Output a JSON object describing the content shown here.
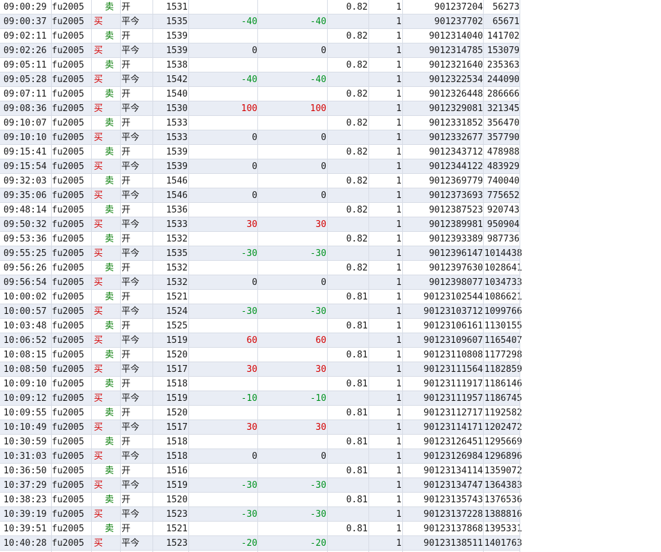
{
  "rows": [
    {
      "time": "09:00:29",
      "code": "fu2005",
      "dir": "卖",
      "oc": "开",
      "price": "1531",
      "pnl": "",
      "pnl2": "",
      "fee": "0.82",
      "qty": "1",
      "order": "901237204",
      "trade": "56273"
    },
    {
      "time": "09:00:37",
      "code": "fu2005",
      "dir": "买",
      "oc": "平今",
      "price": "1535",
      "pnl": "-40",
      "pnl2": "-40",
      "fee": "",
      "qty": "1",
      "order": "901237702",
      "trade": "65671"
    },
    {
      "time": "09:02:11",
      "code": "fu2005",
      "dir": "卖",
      "oc": "开",
      "price": "1539",
      "pnl": "",
      "pnl2": "",
      "fee": "0.82",
      "qty": "1",
      "order": "9012314040",
      "trade": "141702"
    },
    {
      "time": "09:02:26",
      "code": "fu2005",
      "dir": "买",
      "oc": "平今",
      "price": "1539",
      "pnl": "0",
      "pnl2": "0",
      "fee": "",
      "qty": "1",
      "order": "9012314785",
      "trade": "153079"
    },
    {
      "time": "09:05:11",
      "code": "fu2005",
      "dir": "卖",
      "oc": "开",
      "price": "1538",
      "pnl": "",
      "pnl2": "",
      "fee": "0.82",
      "qty": "1",
      "order": "9012321640",
      "trade": "235363"
    },
    {
      "time": "09:05:28",
      "code": "fu2005",
      "dir": "买",
      "oc": "平今",
      "price": "1542",
      "pnl": "-40",
      "pnl2": "-40",
      "fee": "",
      "qty": "1",
      "order": "9012322534",
      "trade": "244090"
    },
    {
      "time": "09:07:11",
      "code": "fu2005",
      "dir": "卖",
      "oc": "开",
      "price": "1540",
      "pnl": "",
      "pnl2": "",
      "fee": "0.82",
      "qty": "1",
      "order": "9012326448",
      "trade": "286666"
    },
    {
      "time": "09:08:36",
      "code": "fu2005",
      "dir": "买",
      "oc": "平今",
      "price": "1530",
      "pnl": "100",
      "pnl2": "100",
      "fee": "",
      "qty": "1",
      "order": "9012329081",
      "trade": "321345"
    },
    {
      "time": "09:10:07",
      "code": "fu2005",
      "dir": "卖",
      "oc": "开",
      "price": "1533",
      "pnl": "",
      "pnl2": "",
      "fee": "0.82",
      "qty": "1",
      "order": "9012331852",
      "trade": "356470"
    },
    {
      "time": "09:10:10",
      "code": "fu2005",
      "dir": "买",
      "oc": "平今",
      "price": "1533",
      "pnl": "0",
      "pnl2": "0",
      "fee": "",
      "qty": "1",
      "order": "9012332677",
      "trade": "357790"
    },
    {
      "time": "09:15:41",
      "code": "fu2005",
      "dir": "卖",
      "oc": "开",
      "price": "1539",
      "pnl": "",
      "pnl2": "",
      "fee": "0.82",
      "qty": "1",
      "order": "9012343712",
      "trade": "478988"
    },
    {
      "time": "09:15:54",
      "code": "fu2005",
      "dir": "买",
      "oc": "平今",
      "price": "1539",
      "pnl": "0",
      "pnl2": "0",
      "fee": "",
      "qty": "1",
      "order": "9012344122",
      "trade": "483929"
    },
    {
      "time": "09:32:03",
      "code": "fu2005",
      "dir": "卖",
      "oc": "开",
      "price": "1546",
      "pnl": "",
      "pnl2": "",
      "fee": "0.82",
      "qty": "1",
      "order": "9012369779",
      "trade": "740040"
    },
    {
      "time": "09:35:06",
      "code": "fu2005",
      "dir": "买",
      "oc": "平今",
      "price": "1546",
      "pnl": "0",
      "pnl2": "0",
      "fee": "",
      "qty": "1",
      "order": "9012373693",
      "trade": "775652"
    },
    {
      "time": "09:48:14",
      "code": "fu2005",
      "dir": "卖",
      "oc": "开",
      "price": "1536",
      "pnl": "",
      "pnl2": "",
      "fee": "0.82",
      "qty": "1",
      "order": "9012387523",
      "trade": "920743"
    },
    {
      "time": "09:50:32",
      "code": "fu2005",
      "dir": "买",
      "oc": "平今",
      "price": "1533",
      "pnl": "30",
      "pnl2": "30",
      "fee": "",
      "qty": "1",
      "order": "9012389981",
      "trade": "950904"
    },
    {
      "time": "09:53:36",
      "code": "fu2005",
      "dir": "卖",
      "oc": "开",
      "price": "1532",
      "pnl": "",
      "pnl2": "",
      "fee": "0.82",
      "qty": "1",
      "order": "9012393389",
      "trade": "987736"
    },
    {
      "time": "09:55:25",
      "code": "fu2005",
      "dir": "买",
      "oc": "平今",
      "price": "1535",
      "pnl": "-30",
      "pnl2": "-30",
      "fee": "",
      "qty": "1",
      "order": "9012396147",
      "trade": "1014438"
    },
    {
      "time": "09:56:26",
      "code": "fu2005",
      "dir": "卖",
      "oc": "开",
      "price": "1532",
      "pnl": "",
      "pnl2": "",
      "fee": "0.82",
      "qty": "1",
      "order": "9012397630",
      "trade": "1028641"
    },
    {
      "time": "09:56:54",
      "code": "fu2005",
      "dir": "买",
      "oc": "平今",
      "price": "1532",
      "pnl": "0",
      "pnl2": "0",
      "fee": "",
      "qty": "1",
      "order": "9012398077",
      "trade": "1034733"
    },
    {
      "time": "10:00:02",
      "code": "fu2005",
      "dir": "卖",
      "oc": "开",
      "price": "1521",
      "pnl": "",
      "pnl2": "",
      "fee": "0.81",
      "qty": "1",
      "order": "90123102544",
      "trade": "1086621"
    },
    {
      "time": "10:00:57",
      "code": "fu2005",
      "dir": "买",
      "oc": "平今",
      "price": "1524",
      "pnl": "-30",
      "pnl2": "-30",
      "fee": "",
      "qty": "1",
      "order": "90123103712",
      "trade": "1099766"
    },
    {
      "time": "10:03:48",
      "code": "fu2005",
      "dir": "卖",
      "oc": "开",
      "price": "1525",
      "pnl": "",
      "pnl2": "",
      "fee": "0.81",
      "qty": "1",
      "order": "90123106161",
      "trade": "1130155"
    },
    {
      "time": "10:06:52",
      "code": "fu2005",
      "dir": "买",
      "oc": "平今",
      "price": "1519",
      "pnl": "60",
      "pnl2": "60",
      "fee": "",
      "qty": "1",
      "order": "90123109607",
      "trade": "1165407"
    },
    {
      "time": "10:08:15",
      "code": "fu2005",
      "dir": "卖",
      "oc": "开",
      "price": "1520",
      "pnl": "",
      "pnl2": "",
      "fee": "0.81",
      "qty": "1",
      "order": "90123110808",
      "trade": "1177298"
    },
    {
      "time": "10:08:50",
      "code": "fu2005",
      "dir": "买",
      "oc": "平今",
      "price": "1517",
      "pnl": "30",
      "pnl2": "30",
      "fee": "",
      "qty": "1",
      "order": "90123111564",
      "trade": "1182859"
    },
    {
      "time": "10:09:10",
      "code": "fu2005",
      "dir": "卖",
      "oc": "开",
      "price": "1518",
      "pnl": "",
      "pnl2": "",
      "fee": "0.81",
      "qty": "1",
      "order": "90123111917",
      "trade": "1186146"
    },
    {
      "time": "10:09:12",
      "code": "fu2005",
      "dir": "买",
      "oc": "平今",
      "price": "1519",
      "pnl": "-10",
      "pnl2": "-10",
      "fee": "",
      "qty": "1",
      "order": "90123111957",
      "trade": "1186745"
    },
    {
      "time": "10:09:55",
      "code": "fu2005",
      "dir": "卖",
      "oc": "开",
      "price": "1520",
      "pnl": "",
      "pnl2": "",
      "fee": "0.81",
      "qty": "1",
      "order": "90123112717",
      "trade": "1192582"
    },
    {
      "time": "10:10:49",
      "code": "fu2005",
      "dir": "买",
      "oc": "平今",
      "price": "1517",
      "pnl": "30",
      "pnl2": "30",
      "fee": "",
      "qty": "1",
      "order": "90123114171",
      "trade": "1202472"
    },
    {
      "time": "10:30:59",
      "code": "fu2005",
      "dir": "卖",
      "oc": "开",
      "price": "1518",
      "pnl": "",
      "pnl2": "",
      "fee": "0.81",
      "qty": "1",
      "order": "90123126451",
      "trade": "1295669"
    },
    {
      "time": "10:31:03",
      "code": "fu2005",
      "dir": "买",
      "oc": "平今",
      "price": "1518",
      "pnl": "0",
      "pnl2": "0",
      "fee": "",
      "qty": "1",
      "order": "90123126984",
      "trade": "1296896"
    },
    {
      "time": "10:36:50",
      "code": "fu2005",
      "dir": "卖",
      "oc": "开",
      "price": "1516",
      "pnl": "",
      "pnl2": "",
      "fee": "0.81",
      "qty": "1",
      "order": "90123134114",
      "trade": "1359072"
    },
    {
      "time": "10:37:29",
      "code": "fu2005",
      "dir": "买",
      "oc": "平今",
      "price": "1519",
      "pnl": "-30",
      "pnl2": "-30",
      "fee": "",
      "qty": "1",
      "order": "90123134747",
      "trade": "1364383"
    },
    {
      "time": "10:38:23",
      "code": "fu2005",
      "dir": "卖",
      "oc": "开",
      "price": "1520",
      "pnl": "",
      "pnl2": "",
      "fee": "0.81",
      "qty": "1",
      "order": "90123135743",
      "trade": "1376536"
    },
    {
      "time": "10:39:19",
      "code": "fu2005",
      "dir": "买",
      "oc": "平今",
      "price": "1523",
      "pnl": "-30",
      "pnl2": "-30",
      "fee": "",
      "qty": "1",
      "order": "90123137228",
      "trade": "1388816"
    },
    {
      "time": "10:39:51",
      "code": "fu2005",
      "dir": "卖",
      "oc": "开",
      "price": "1521",
      "pnl": "",
      "pnl2": "",
      "fee": "0.81",
      "qty": "1",
      "order": "90123137868",
      "trade": "1395331"
    },
    {
      "time": "10:40:28",
      "code": "fu2005",
      "dir": "买",
      "oc": "平今",
      "price": "1523",
      "pnl": "-20",
      "pnl2": "-20",
      "fee": "",
      "qty": "1",
      "order": "90123138511",
      "trade": "1401763"
    }
  ],
  "colors": {
    "buy": "#d40000",
    "sell": "#007a00",
    "profit": "#d40000",
    "loss": "#00921f",
    "row_alt": "#e9edf5"
  }
}
